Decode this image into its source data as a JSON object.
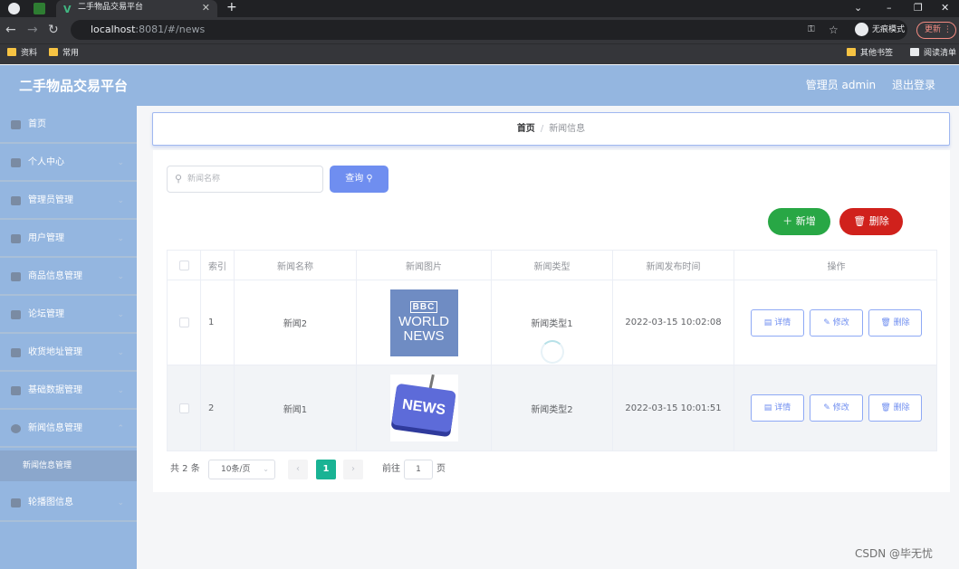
{
  "browser": {
    "tab_title": "二手物品交易平台",
    "url_host": "localhost",
    "url_rest": ":8081/#/news",
    "incognito_label": "无痕模式",
    "update_label": "更新",
    "bookmarks": [
      "资料",
      "常用"
    ],
    "bookmarks_right": [
      "其他书签",
      "阅读清单"
    ]
  },
  "header": {
    "brand": "二手物品交易平台",
    "user": "管理员 admin",
    "logout": "退出登录"
  },
  "sidebar": {
    "items": [
      {
        "label": "首页",
        "icon": "home-icon"
      },
      {
        "label": "个人中心",
        "icon": "user-icon"
      },
      {
        "label": "管理员管理",
        "icon": "grid-icon"
      },
      {
        "label": "用户管理",
        "icon": "card-icon"
      },
      {
        "label": "商品信息管理",
        "icon": "send-icon"
      },
      {
        "label": "论坛管理",
        "icon": "chart-icon"
      },
      {
        "label": "收货地址管理",
        "icon": "crop-icon"
      },
      {
        "label": "基础数据管理",
        "icon": "monitor-icon"
      },
      {
        "label": "新闻信息管理",
        "icon": "clock-icon"
      },
      {
        "label": "轮播图信息",
        "icon": "apps-icon"
      }
    ],
    "submenu": {
      "label": "新闻信息管理"
    }
  },
  "breadcrumb": {
    "home": "首页",
    "sep": "/",
    "current": "新闻信息"
  },
  "toolbar": {
    "search_placeholder": "新闻名称",
    "query_label": "查询",
    "add_label": "新增",
    "delete_label": "删除"
  },
  "table": {
    "headers": [
      "索引",
      "新闻名称",
      "新闻图片",
      "新闻类型",
      "新闻发布时间",
      "操作"
    ],
    "rows": [
      {
        "index": "1",
        "name": "新闻2",
        "image": "BBC WORLD NEWS",
        "type": "新闻类型1",
        "time": "2022-03-15 10:02:08"
      },
      {
        "index": "2",
        "name": "新闻1",
        "image": "NEWS",
        "type": "新闻类型2",
        "time": "2022-03-15 10:01:51"
      }
    ],
    "ops": {
      "detail": "详情",
      "edit": "修改",
      "delete": "删除"
    }
  },
  "pagination": {
    "total": "共 2 条",
    "page_size": "10条/页",
    "current": "1",
    "goto_label": "前往",
    "goto_value": "1",
    "page_label": "页"
  },
  "watermark": "CSDN @毕无忧",
  "colors": {
    "sidebar": "#94b6e0",
    "primary": "#6f8ef0",
    "success": "#28a745",
    "danger": "#d0211c",
    "pager_active": "#19b394"
  }
}
